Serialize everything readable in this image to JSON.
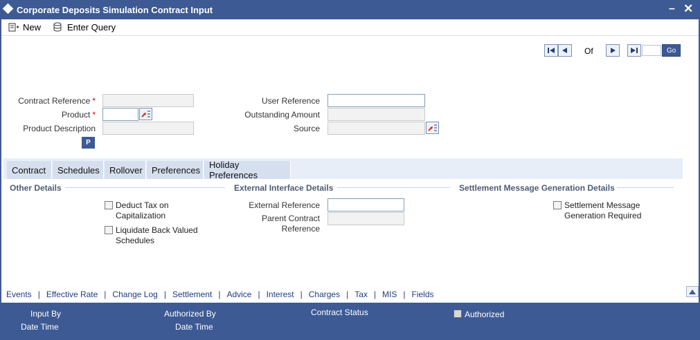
{
  "window": {
    "title": "Corporate Deposits Simulation Contract Input"
  },
  "toolbar": {
    "new_label": "New",
    "enter_query_label": "Enter Query"
  },
  "pagination": {
    "of_label": "Of",
    "go_label": "Go",
    "page_value": ""
  },
  "header_fields": {
    "contract_reference_label": "Contract Reference",
    "product_label": "Product",
    "product_description_label": "Product Description",
    "user_reference_label": "User Reference",
    "outstanding_amount_label": "Outstanding Amount",
    "source_label": "Source",
    "required_marker": "*",
    "p_button_label": "P"
  },
  "tabs": [
    {
      "label": "Contract"
    },
    {
      "label": "Schedules"
    },
    {
      "label": "Rollover"
    },
    {
      "label": "Preferences"
    },
    {
      "label": "Holiday Preferences"
    }
  ],
  "sections": {
    "other_details": {
      "title": "Other Details",
      "deduct_tax_line1": "Deduct Tax on",
      "deduct_tax_line2": "Capitalization",
      "liquidate_line1": "Liquidate Back Valued",
      "liquidate_line2": "Schedules"
    },
    "external_interface": {
      "title": "External Interface Details",
      "external_reference_label": "External Reference",
      "parent_contract_line1": "Parent Contract",
      "parent_contract_line2": "Reference"
    },
    "settlement_message": {
      "title": "Settlement Message Generation Details",
      "checkbox_line1": "Settlement Message",
      "checkbox_line2": "Generation Required"
    }
  },
  "bottom_links": [
    "Events",
    "Effective Rate",
    "Change Log",
    "Settlement",
    "Advice",
    "Interest",
    "Charges",
    "Tax",
    "MIS",
    "Fields"
  ],
  "footer": {
    "input_by_label": "Input By",
    "date_time_label": "Date Time",
    "authorized_by_label": "Authorized By",
    "date_time_label_2": "Date Time",
    "contract_status_label": "Contract Status",
    "authorized_label": "Authorized"
  },
  "colors": {
    "brand": "#3d5a94",
    "tab_bg": "#d6dfee",
    "required": "#cc0000"
  }
}
